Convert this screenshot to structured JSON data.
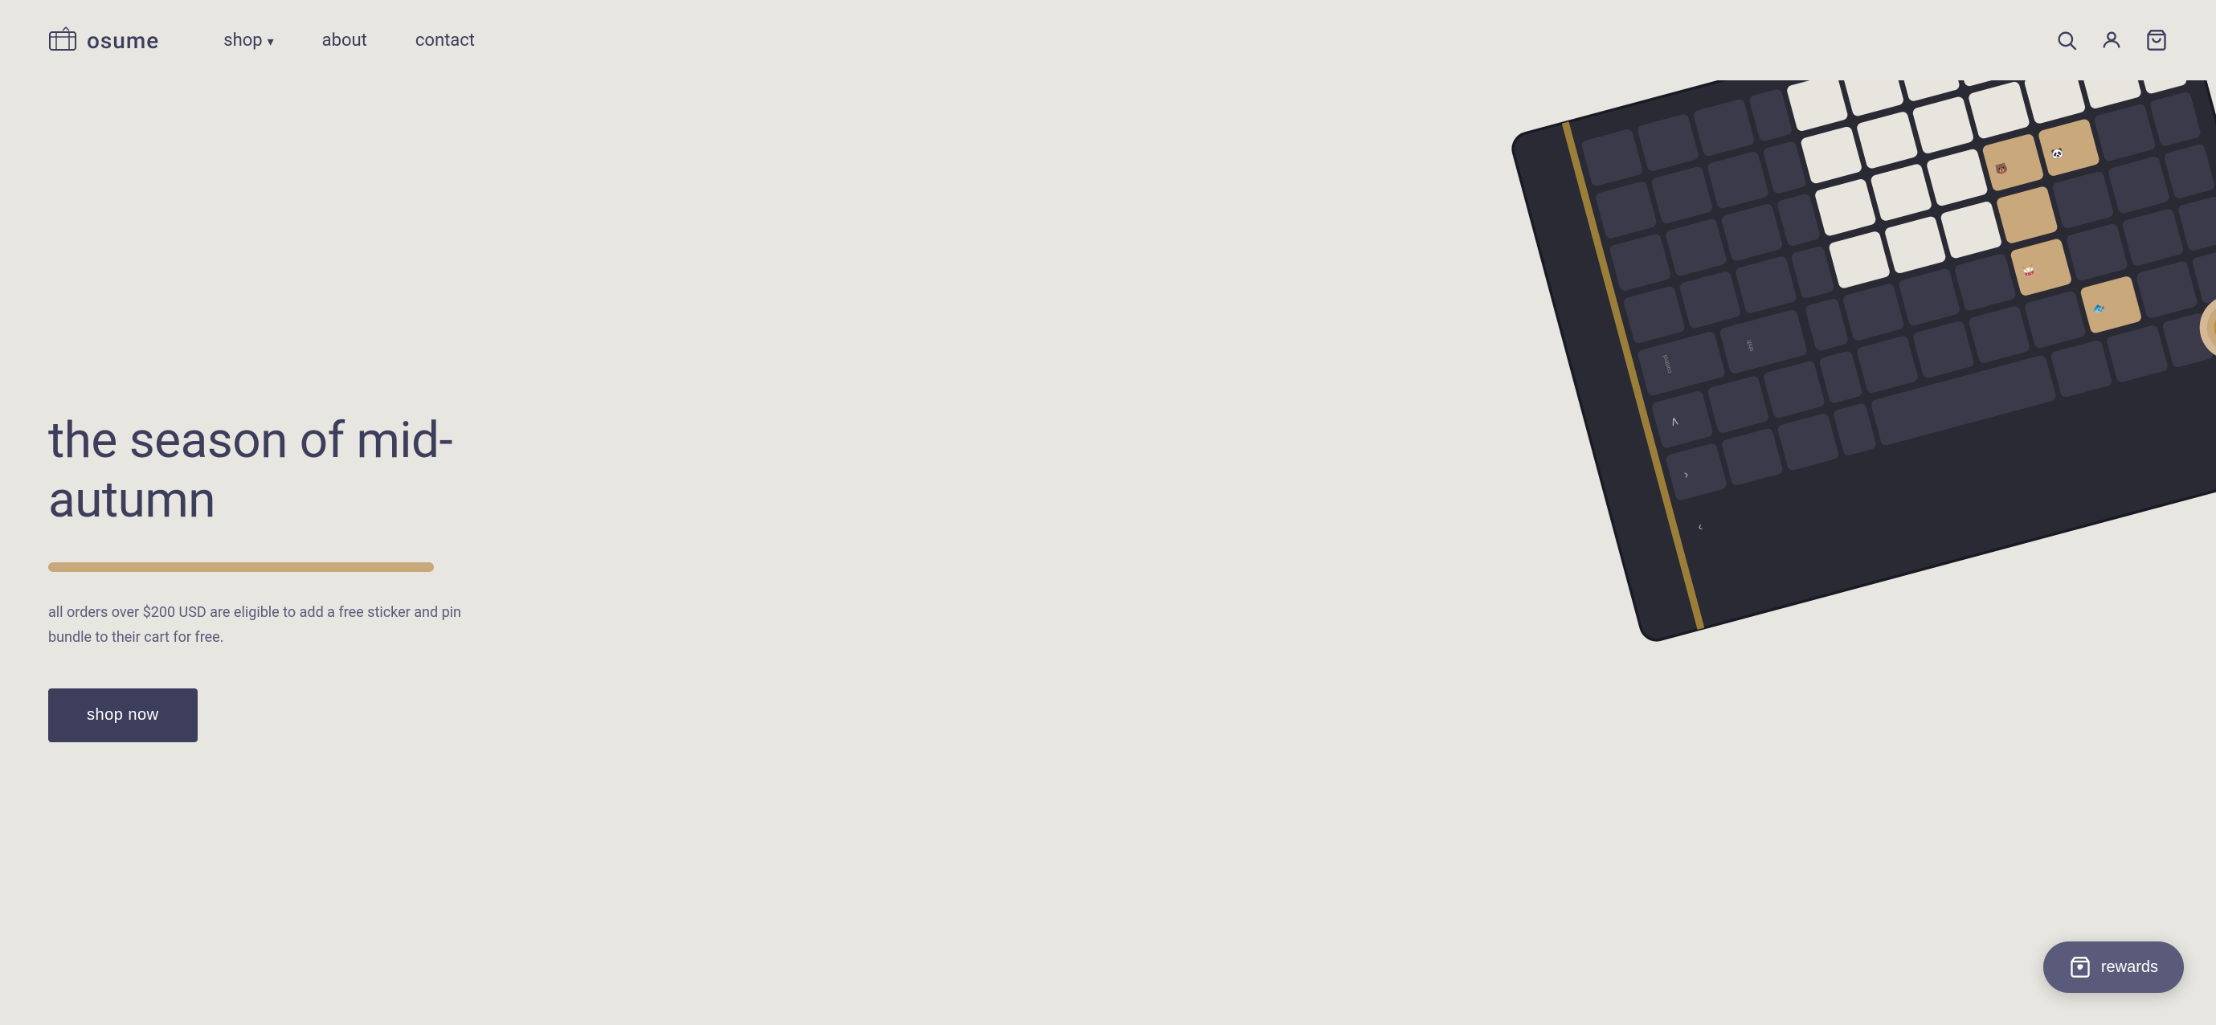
{
  "brand": {
    "name": "osume",
    "logo_alt": "osume box logo"
  },
  "navbar": {
    "shop_label": "shop",
    "about_label": "about",
    "contact_label": "contact",
    "search_icon": "search",
    "account_icon": "user",
    "cart_icon": "cart"
  },
  "hero": {
    "title": "the season of mid-autumn",
    "description": "all orders over $200 USD are eligible to add a free sticker and pin bundle to their cart for free.",
    "cta_label": "shop now",
    "divider_color": "#c9a87c"
  },
  "rewards": {
    "label": "rewards",
    "icon": "bag-heart"
  },
  "colors": {
    "bg": "#e8e6e1",
    "text_primary": "#3d3d5c",
    "text_secondary": "#5a5a7a",
    "accent": "#c9a87c",
    "btn_bg": "#3d3d5c",
    "rewards_bg": "#5a5a7a",
    "keyboard_dark": "#2a2a35",
    "key_dark": "#3a3a4a",
    "key_white": "#e8e4de",
    "key_tan": "#c9a87c"
  }
}
